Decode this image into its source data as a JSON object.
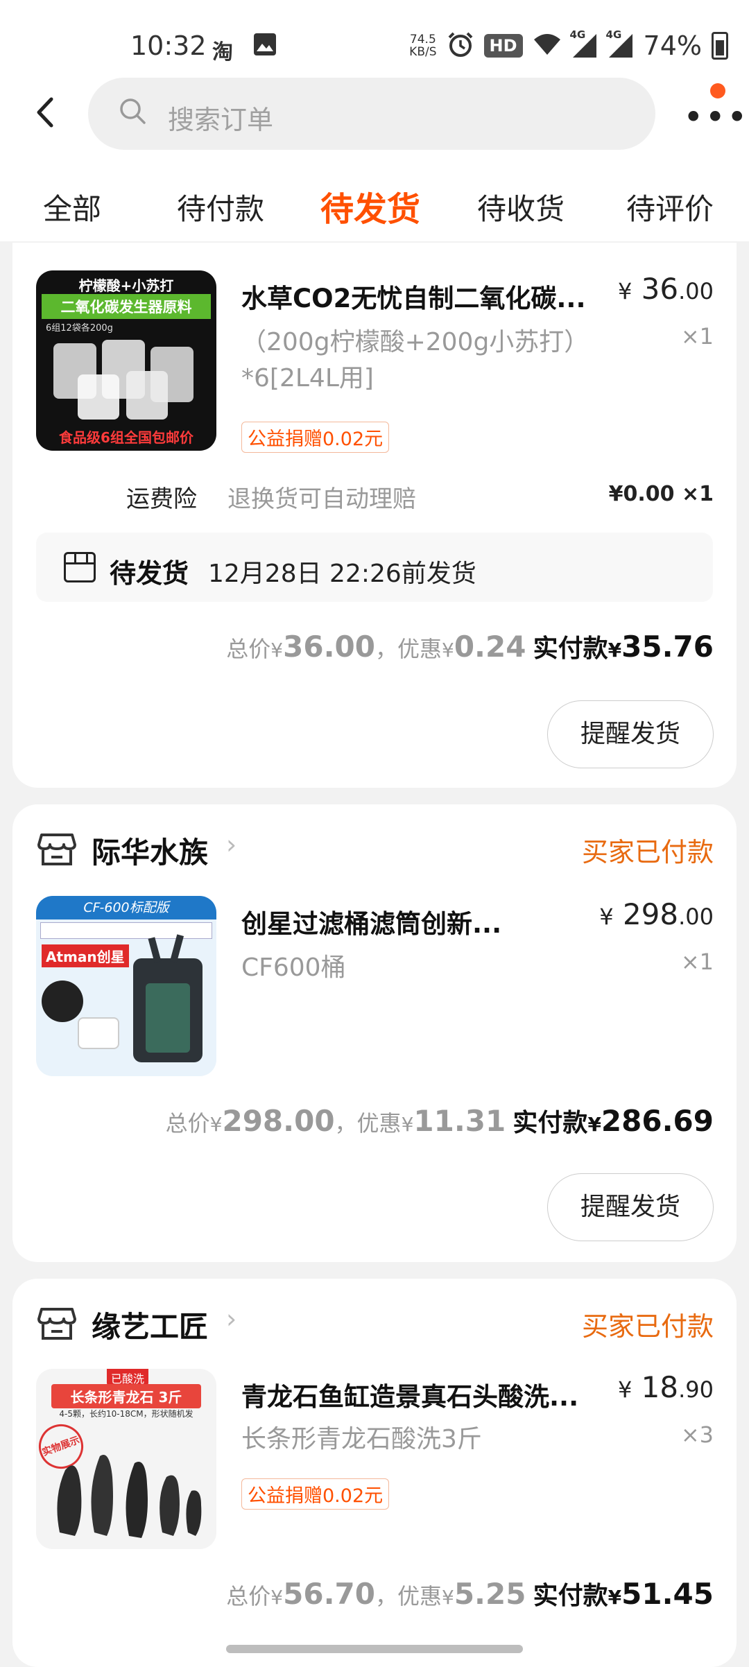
{
  "status_bar": {
    "time": "10:32",
    "app_icon": "taobao-icon",
    "speed_value": "74.5",
    "speed_unit": "KB/S",
    "hd_label": "HD",
    "network_1": "4G",
    "network_2": "4G",
    "battery": "74%"
  },
  "header": {
    "search_placeholder": "搜索订单"
  },
  "tabs": [
    {
      "label": "全部",
      "active": false
    },
    {
      "label": "待付款",
      "active": false
    },
    {
      "label": "待发货",
      "active": true
    },
    {
      "label": "待收货",
      "active": false
    },
    {
      "label": "待评价",
      "active": false
    }
  ],
  "colors": {
    "accent": "#ff5000",
    "status_orange": "#e86a10"
  },
  "orders": [
    {
      "shop": null,
      "product": {
        "thumb_top_text": "柠檬酸+小苏打",
        "thumb_band_text": "二氧化碳发生器原料",
        "thumb_small_text": "6组12袋各200g",
        "thumb_bottom_text": "食品级6组全国包邮价",
        "title": "水草CO2无忧自制二氧化碳...",
        "sku": "（200g柠檬酸+200g小苏打）*6[2L4L用]",
        "price_yen": "¥",
        "price_int": "36",
        "price_dec": ".00",
        "qty": "×1",
        "charity": "公益捐赠0.02元"
      },
      "insurance": {
        "label": "运费险",
        "desc": "退换货可自动理赔",
        "price": "¥0.00 ×1"
      },
      "shipping": {
        "status": "待发货",
        "time": "12月28日 22:26前发货"
      },
      "totals": {
        "total_label": "总价",
        "total": "36.00",
        "discount_label": "，优惠",
        "discount": "0.24",
        "pay_label": "实付款",
        "pay": "35.76"
      },
      "remind_label": "提醒发货"
    },
    {
      "shop": {
        "name": "际华水族",
        "status": "买家已付款"
      },
      "product": {
        "thumb_top_text": "CF-600标配版",
        "thumb_brand": "Atman创星",
        "title": "创星过滤桶滤筒创新...",
        "sku": "CF600桶",
        "price_yen": "¥",
        "price_int": "298",
        "price_dec": ".00",
        "qty": "×1"
      },
      "totals": {
        "total_label": "总价",
        "total": "298.00",
        "discount_label": "，优惠",
        "discount": "11.31",
        "pay_label": "实付款",
        "pay": "286.69"
      },
      "remind_label": "提醒发货"
    },
    {
      "shop": {
        "name": "缘艺工匠",
        "status": "买家已付款"
      },
      "product": {
        "thumb_tag": "已酸洗",
        "thumb_banner": "长条形青龙石 3斤",
        "thumb_sub": "4-5颗，长约10-18CM，形状随机发",
        "thumb_stamp": "实物展示",
        "title": "青龙石鱼缸造景真石头酸洗...",
        "sku": "长条形青龙石酸洗3斤",
        "price_yen": "¥",
        "price_int": "18",
        "price_dec": ".90",
        "qty": "×3",
        "charity": "公益捐赠0.02元"
      },
      "totals": {
        "total_label": "总价",
        "total": "56.70",
        "discount_label": "，优惠",
        "discount": "5.25",
        "pay_label": "实付款",
        "pay": "51.45"
      }
    }
  ]
}
